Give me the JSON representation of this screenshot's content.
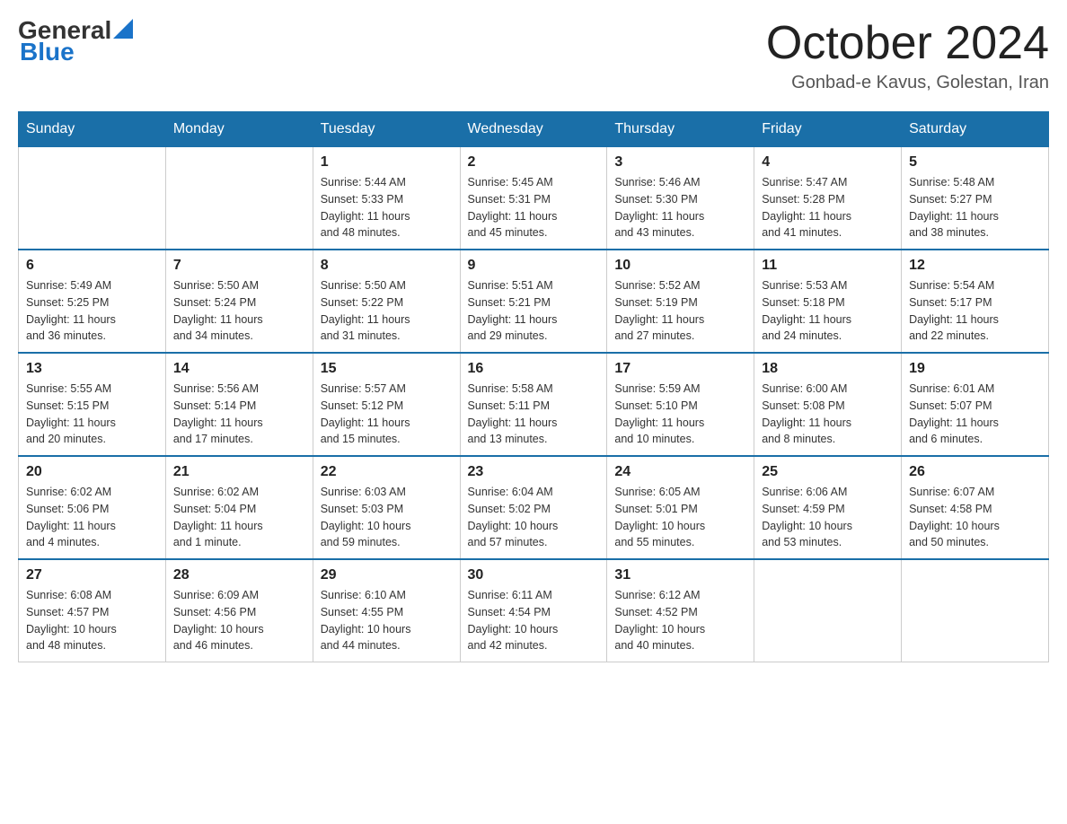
{
  "header": {
    "title": "October 2024",
    "subtitle": "Gonbad-e Kavus, Golestan, Iran",
    "logo_general": "General",
    "logo_blue": "Blue"
  },
  "days_of_week": [
    "Sunday",
    "Monday",
    "Tuesday",
    "Wednesday",
    "Thursday",
    "Friday",
    "Saturday"
  ],
  "weeks": [
    [
      {
        "day": "",
        "info": ""
      },
      {
        "day": "",
        "info": ""
      },
      {
        "day": "1",
        "info": "Sunrise: 5:44 AM\nSunset: 5:33 PM\nDaylight: 11 hours\nand 48 minutes."
      },
      {
        "day": "2",
        "info": "Sunrise: 5:45 AM\nSunset: 5:31 PM\nDaylight: 11 hours\nand 45 minutes."
      },
      {
        "day": "3",
        "info": "Sunrise: 5:46 AM\nSunset: 5:30 PM\nDaylight: 11 hours\nand 43 minutes."
      },
      {
        "day": "4",
        "info": "Sunrise: 5:47 AM\nSunset: 5:28 PM\nDaylight: 11 hours\nand 41 minutes."
      },
      {
        "day": "5",
        "info": "Sunrise: 5:48 AM\nSunset: 5:27 PM\nDaylight: 11 hours\nand 38 minutes."
      }
    ],
    [
      {
        "day": "6",
        "info": "Sunrise: 5:49 AM\nSunset: 5:25 PM\nDaylight: 11 hours\nand 36 minutes."
      },
      {
        "day": "7",
        "info": "Sunrise: 5:50 AM\nSunset: 5:24 PM\nDaylight: 11 hours\nand 34 minutes."
      },
      {
        "day": "8",
        "info": "Sunrise: 5:50 AM\nSunset: 5:22 PM\nDaylight: 11 hours\nand 31 minutes."
      },
      {
        "day": "9",
        "info": "Sunrise: 5:51 AM\nSunset: 5:21 PM\nDaylight: 11 hours\nand 29 minutes."
      },
      {
        "day": "10",
        "info": "Sunrise: 5:52 AM\nSunset: 5:19 PM\nDaylight: 11 hours\nand 27 minutes."
      },
      {
        "day": "11",
        "info": "Sunrise: 5:53 AM\nSunset: 5:18 PM\nDaylight: 11 hours\nand 24 minutes."
      },
      {
        "day": "12",
        "info": "Sunrise: 5:54 AM\nSunset: 5:17 PM\nDaylight: 11 hours\nand 22 minutes."
      }
    ],
    [
      {
        "day": "13",
        "info": "Sunrise: 5:55 AM\nSunset: 5:15 PM\nDaylight: 11 hours\nand 20 minutes."
      },
      {
        "day": "14",
        "info": "Sunrise: 5:56 AM\nSunset: 5:14 PM\nDaylight: 11 hours\nand 17 minutes."
      },
      {
        "day": "15",
        "info": "Sunrise: 5:57 AM\nSunset: 5:12 PM\nDaylight: 11 hours\nand 15 minutes."
      },
      {
        "day": "16",
        "info": "Sunrise: 5:58 AM\nSunset: 5:11 PM\nDaylight: 11 hours\nand 13 minutes."
      },
      {
        "day": "17",
        "info": "Sunrise: 5:59 AM\nSunset: 5:10 PM\nDaylight: 11 hours\nand 10 minutes."
      },
      {
        "day": "18",
        "info": "Sunrise: 6:00 AM\nSunset: 5:08 PM\nDaylight: 11 hours\nand 8 minutes."
      },
      {
        "day": "19",
        "info": "Sunrise: 6:01 AM\nSunset: 5:07 PM\nDaylight: 11 hours\nand 6 minutes."
      }
    ],
    [
      {
        "day": "20",
        "info": "Sunrise: 6:02 AM\nSunset: 5:06 PM\nDaylight: 11 hours\nand 4 minutes."
      },
      {
        "day": "21",
        "info": "Sunrise: 6:02 AM\nSunset: 5:04 PM\nDaylight: 11 hours\nand 1 minute."
      },
      {
        "day": "22",
        "info": "Sunrise: 6:03 AM\nSunset: 5:03 PM\nDaylight: 10 hours\nand 59 minutes."
      },
      {
        "day": "23",
        "info": "Sunrise: 6:04 AM\nSunset: 5:02 PM\nDaylight: 10 hours\nand 57 minutes."
      },
      {
        "day": "24",
        "info": "Sunrise: 6:05 AM\nSunset: 5:01 PM\nDaylight: 10 hours\nand 55 minutes."
      },
      {
        "day": "25",
        "info": "Sunrise: 6:06 AM\nSunset: 4:59 PM\nDaylight: 10 hours\nand 53 minutes."
      },
      {
        "day": "26",
        "info": "Sunrise: 6:07 AM\nSunset: 4:58 PM\nDaylight: 10 hours\nand 50 minutes."
      }
    ],
    [
      {
        "day": "27",
        "info": "Sunrise: 6:08 AM\nSunset: 4:57 PM\nDaylight: 10 hours\nand 48 minutes."
      },
      {
        "day": "28",
        "info": "Sunrise: 6:09 AM\nSunset: 4:56 PM\nDaylight: 10 hours\nand 46 minutes."
      },
      {
        "day": "29",
        "info": "Sunrise: 6:10 AM\nSunset: 4:55 PM\nDaylight: 10 hours\nand 44 minutes."
      },
      {
        "day": "30",
        "info": "Sunrise: 6:11 AM\nSunset: 4:54 PM\nDaylight: 10 hours\nand 42 minutes."
      },
      {
        "day": "31",
        "info": "Sunrise: 6:12 AM\nSunset: 4:52 PM\nDaylight: 10 hours\nand 40 minutes."
      },
      {
        "day": "",
        "info": ""
      },
      {
        "day": "",
        "info": ""
      }
    ]
  ]
}
